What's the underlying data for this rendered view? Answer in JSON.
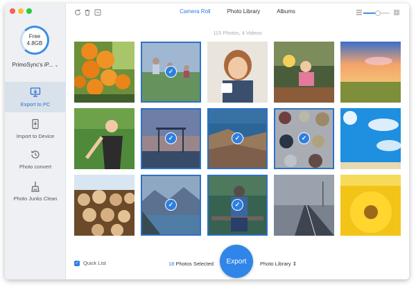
{
  "sidebar": {
    "storage_label": "Free",
    "storage_value": "4.8GB",
    "device_name": "PrimoSync's iP...",
    "items": [
      {
        "label": "Export to PC"
      },
      {
        "label": "Import to Device"
      },
      {
        "label": "Photo convert"
      },
      {
        "label": "Photo Junks Clean"
      }
    ]
  },
  "toolbar": {
    "tabs": [
      {
        "label": "Camera Roll"
      },
      {
        "label": "Photo Library"
      },
      {
        "label": "Albums"
      }
    ],
    "active_tab": "Camera Roll",
    "zoom_level": 0.55
  },
  "main": {
    "count_text": "115 Photos, 4 Videos",
    "photos": [
      {
        "subject": "oranges on tree",
        "selected": false
      },
      {
        "subject": "kids running on grass",
        "selected": true
      },
      {
        "subject": "smiling girl with cup",
        "selected": false
      },
      {
        "subject": "girl at table",
        "selected": false
      },
      {
        "subject": "sunset over field",
        "selected": false
      },
      {
        "subject": "woman in park",
        "selected": false
      },
      {
        "subject": "pergola at dusk",
        "selected": true
      },
      {
        "subject": "rocky coast",
        "selected": true
      },
      {
        "subject": "spices in bowls",
        "selected": true
      },
      {
        "subject": "blue sky with sun",
        "selected": false
      },
      {
        "subject": "stacked logs",
        "selected": false
      },
      {
        "subject": "mountain lake",
        "selected": true
      },
      {
        "subject": "man on bench with tablet",
        "selected": true
      },
      {
        "subject": "empty road",
        "selected": false
      },
      {
        "subject": "sunflower",
        "selected": false
      }
    ]
  },
  "bottom": {
    "quick_list_label": "Quick List",
    "selected_count": "18",
    "selected_suffix": "Photos Selected",
    "export_label": "Export",
    "destination": "Photo Library"
  },
  "colors": {
    "accent": "#2f7fe0"
  }
}
